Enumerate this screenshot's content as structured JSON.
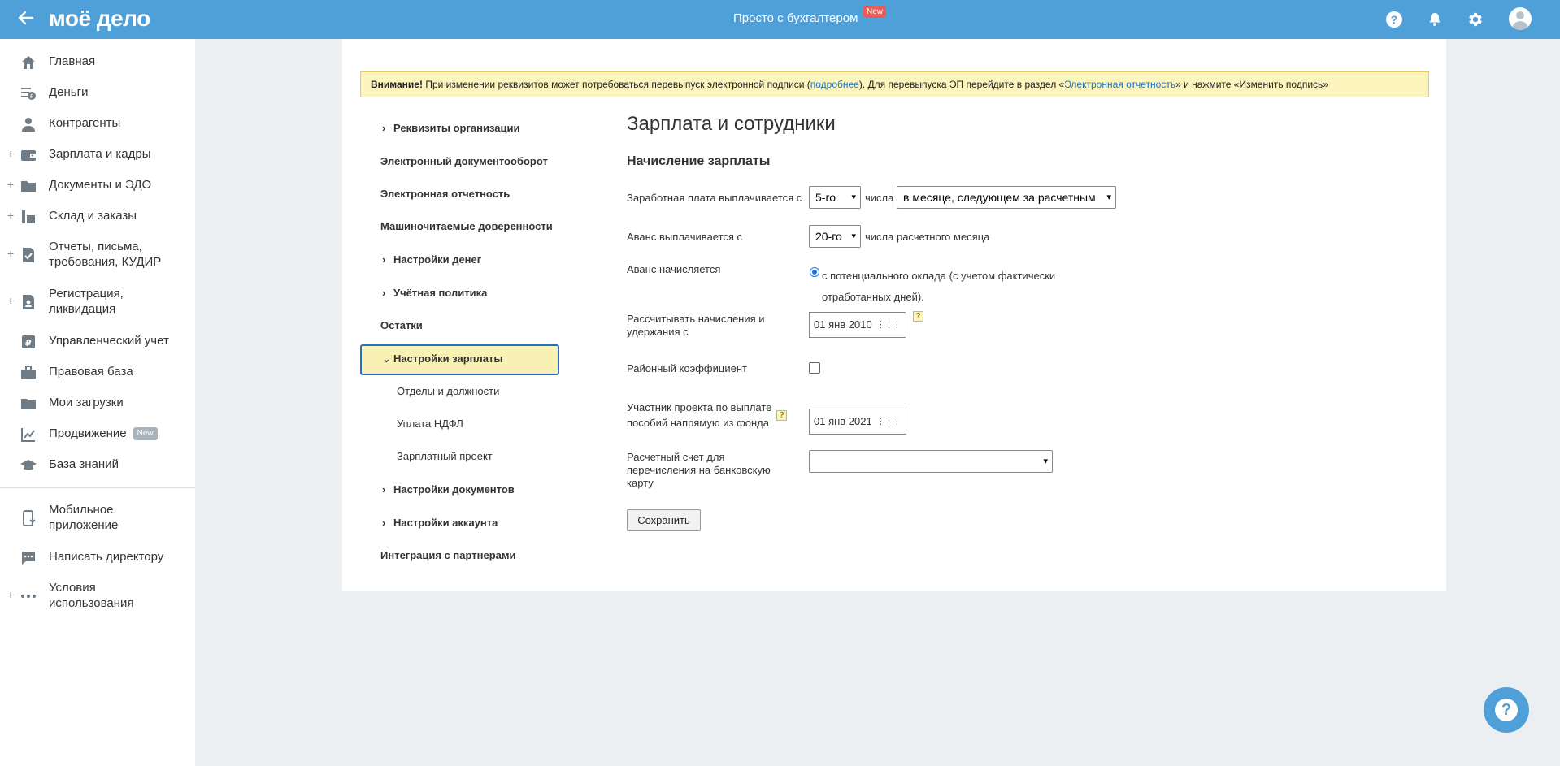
{
  "header": {
    "logo": "моё дело",
    "center_text": "Просто с бухгалтером",
    "new_badge": "New",
    "help_icon": "?"
  },
  "sidebar": {
    "items": [
      {
        "label": "Главная",
        "plus": false
      },
      {
        "label": "Деньги",
        "plus": false
      },
      {
        "label": "Контрагенты",
        "plus": false
      },
      {
        "label": "Зарплата и кадры",
        "plus": true
      },
      {
        "label": "Документы и ЭДО",
        "plus": true
      },
      {
        "label": "Склад и заказы",
        "plus": true
      },
      {
        "label": "Отчеты, письма, требования, КУДИР",
        "plus": true
      },
      {
        "label": "Регистрация, ликвидация",
        "plus": true
      },
      {
        "label": "Управленческий учет",
        "plus": false
      },
      {
        "label": "Правовая база",
        "plus": false
      },
      {
        "label": "Мои загрузки",
        "plus": false
      },
      {
        "label": "Продвижение",
        "plus": false,
        "badge": "New"
      },
      {
        "label": "База знаний",
        "plus": false
      }
    ],
    "bottom_items": [
      {
        "label": "Мобильное приложение"
      },
      {
        "label": "Написать директору"
      },
      {
        "label": "Условия использования"
      }
    ]
  },
  "warning": {
    "bold": "Внимание!",
    "text1": " При изменении реквизитов может потребоваться перевыпуск электронной подписи (",
    "link1": "подробнее",
    "text2": "). Для перевыпуска ЭП перейдите в раздел «",
    "link2": "Электронная отчетность",
    "text3": "» и нажмите «Изменить подпись»"
  },
  "settings_nav": [
    {
      "label": "Реквизиты организации",
      "chevron": ">"
    },
    {
      "label": "Электронный документооборот"
    },
    {
      "label": "Электронная отчетность"
    },
    {
      "label": "Машиночитаемые доверенности"
    },
    {
      "label": "Настройки денег",
      "chevron": ">"
    },
    {
      "label": "Учётная политика",
      "chevron": ">"
    },
    {
      "label": "Остатки"
    },
    {
      "label": "Настройки зарплаты",
      "chevron": "v",
      "active": true
    },
    {
      "label": "Отделы и должности",
      "sub": true
    },
    {
      "label": "Уплата НДФЛ",
      "sub": true
    },
    {
      "label": "Зарплатный проект",
      "sub": true
    },
    {
      "label": "Настройки документов",
      "chevron": ">"
    },
    {
      "label": "Настройки аккаунта",
      "chevron": ">"
    },
    {
      "label": "Интеграция с партнерами"
    }
  ],
  "form": {
    "title": "Зарплата и сотрудники",
    "subtitle": "Начисление зарплаты",
    "salary_label": "Заработная плата выплачивается с",
    "salary_day": "5-го",
    "salary_mid": "числа",
    "salary_month": "в месяце, следующем за расчетным",
    "advance_label": "Аванс выплачивается с",
    "advance_day": "20-го",
    "advance_suffix": "числа расчетного месяца",
    "advance_calc_label": "Аванс начисляется",
    "advance_calc_option": "с потенциального оклада (с учетом фактически отработанных дней).",
    "calc_from_label": "Рассчитывать начисления и удержания с",
    "calc_from_date": "01 янв 2010",
    "regional_label": "Районный коэффициент",
    "project_label": "Участник проекта по выплате пособий напрямую из фонда",
    "project_date": "01 янв 2021",
    "account_label": "Расчетный счет для перечисления на банковскую карту",
    "account_value": "",
    "save": "Сохранить",
    "qmark": "?"
  },
  "fab": {
    "label": "?"
  }
}
